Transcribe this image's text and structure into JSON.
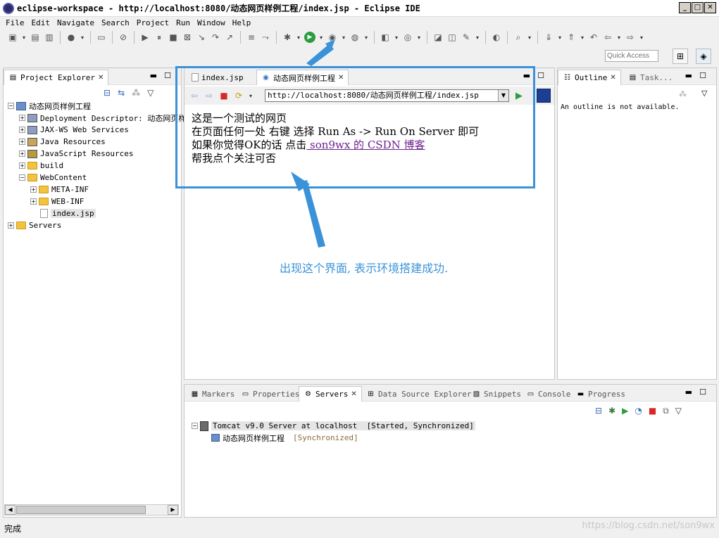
{
  "window": {
    "title": "eclipse-workspace - http://localhost:8080/动态网页样例工程/index.jsp - Eclipse IDE",
    "minimize": "_",
    "maximize": "□",
    "close": "✕"
  },
  "menu": [
    "File",
    "Edit",
    "Navigate",
    "Search",
    "Project",
    "Run",
    "Window",
    "Help"
  ],
  "quick_access": {
    "placeholder": "Quick Access"
  },
  "project_explorer": {
    "tab_label": "Project Explorer",
    "tree": {
      "project": "动态网页样例工程",
      "children": [
        "Deployment Descriptor: 动态网页样",
        "JAX-WS Web Services",
        "Java Resources",
        "JavaScript Resources",
        "build",
        "WebContent"
      ],
      "webcontent_children": [
        "META-INF",
        "WEB-INF",
        "index.jsp"
      ],
      "servers": "Servers"
    }
  },
  "editor": {
    "tabs": [
      {
        "label": "index.jsp"
      },
      {
        "label": "动态网页样例工程"
      }
    ],
    "url": "http://localhost:8080/动态网页样例工程/index.jsp",
    "content": {
      "line1": "这是一个测试的网页",
      "line2": "在页面任何一处 右键 选择 Run As -> Run On Server 即可",
      "line3_prefix": "如果你觉得OK的话 点击",
      "line3_link": " son9wx 的 CSDN 博客",
      "line4": "帮我点个关注可否"
    }
  },
  "annotation": {
    "text": "出现这个界面, 表示环境搭建成功."
  },
  "outline": {
    "tab_label": "Outline",
    "task_label": "Task...",
    "message": "An outline is not available."
  },
  "bottom_panel": {
    "tabs": [
      "Markers",
      "Properties",
      "Servers",
      "Data Source Explorer",
      "Snippets",
      "Console",
      "Progress"
    ],
    "server": {
      "name": "Tomcat v9.0 Server at localhost",
      "state": "[Started, Synchronized]",
      "module": "动态网页样例工程",
      "module_state": "[Synchronized]"
    }
  },
  "status": {
    "text": "完成"
  },
  "watermark": "https://blog.csdn.net/son9wx"
}
